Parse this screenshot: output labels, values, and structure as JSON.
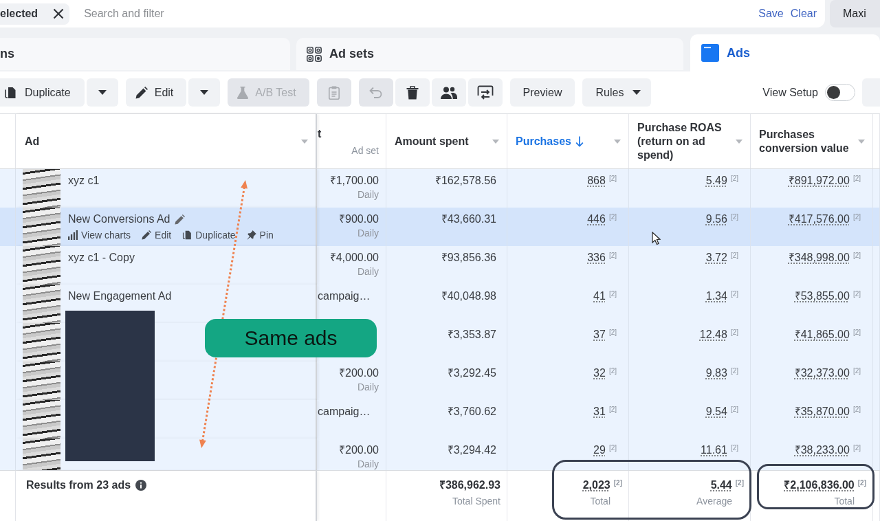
{
  "filter_bar": {
    "chip": {
      "label": "elected"
    },
    "search": {
      "placeholder": "Search and filter"
    },
    "links": [
      "Save",
      "Clear"
    ],
    "side_button": {
      "label": "Maxi"
    }
  },
  "level_tabs": [
    {
      "label": "ns",
      "selected": false
    },
    {
      "label": "Ad sets",
      "selected": false
    },
    {
      "label": "Ads",
      "selected": true
    }
  ],
  "toolbar": {
    "groups": [
      [
        {
          "kind": "button",
          "label": "Duplicate",
          "disabled": false
        },
        {
          "kind": "dropdown",
          "disabled": false
        }
      ],
      [
        {
          "kind": "button",
          "label": "Edit",
          "disabled": false
        },
        {
          "kind": "dropdown",
          "disabled": false
        }
      ],
      [
        {
          "kind": "button",
          "label": "A/B Test",
          "disabled": true
        }
      ],
      [
        {
          "kind": "icon",
          "disabled": true
        }
      ],
      [
        {
          "kind": "icon",
          "disabled": true
        },
        {
          "kind": "icon",
          "disabled": false
        },
        {
          "kind": "icon",
          "disabled": false
        },
        {
          "kind": "icon",
          "disabled": false
        }
      ],
      [
        {
          "kind": "button",
          "label": "Preview",
          "disabled": false
        }
      ],
      [
        {
          "kind": "menu",
          "label": "Rules",
          "disabled": false
        }
      ]
    ],
    "view_setup": {
      "label": "View Setup",
      "on": false
    }
  },
  "table": {
    "columns": [
      {
        "kind": "name",
        "label": "Ad",
        "sorted": false
      },
      {
        "kind": "cut",
        "label": "t",
        "sublabel": "Ad set",
        "sorted": false
      },
      {
        "kind": "metric",
        "label": "Amount spent",
        "sorted": false
      },
      {
        "kind": "metric",
        "label": "Purchases",
        "sorted": true
      },
      {
        "kind": "metric",
        "label": "Purchase ROAS (return on ad spend)",
        "sorted": false
      },
      {
        "kind": "metric",
        "label": "Purchases conversion value",
        "sorted": false
      }
    ],
    "rows": [
      {
        "name": "xyz c1",
        "hovered": false,
        "ad_set": {
          "kind": "budget",
          "value": "₹1,700.00",
          "period": "Daily"
        },
        "amount_spent": "₹162,578.56",
        "purchases": {
          "value": "868",
          "note": "[2]"
        },
        "roas": {
          "value": "5.49",
          "note": "[2]"
        },
        "conversion_value": {
          "value": "₹891,972.00",
          "note": "[2]"
        }
      },
      {
        "name": "New Conversions Ad",
        "hovered": true,
        "actions": [
          "View charts",
          "Edit",
          "Duplicate",
          "Pin"
        ],
        "ad_set": {
          "kind": "budget",
          "value": "₹900.00",
          "period": "Daily"
        },
        "amount_spent": "₹43,660.31",
        "purchases": {
          "value": "446",
          "note": "[2]"
        },
        "roas": {
          "value": "9.56",
          "note": "[2]"
        },
        "conversion_value": {
          "value": "₹417,576.00",
          "note": "[2]"
        }
      },
      {
        "name": "xyz c1 - Copy",
        "hovered": false,
        "ad_set": {
          "kind": "budget",
          "value": "₹4,000.00",
          "period": "Daily"
        },
        "amount_spent": "₹93,856.36",
        "purchases": {
          "value": "336",
          "note": "[2]"
        },
        "roas": {
          "value": "3.72",
          "note": "[2]"
        },
        "conversion_value": {
          "value": "₹348,998.00",
          "note": "[2]"
        }
      },
      {
        "name": "New Engagement Ad",
        "hovered": false,
        "ad_set": {
          "kind": "text",
          "value": "campaig…"
        },
        "amount_spent": "₹40,048.98",
        "purchases": {
          "value": "41",
          "note": "[2]"
        },
        "roas": {
          "value": "1.34",
          "note": "[2]"
        },
        "conversion_value": {
          "value": "₹53,855.00",
          "note": "[2]"
        }
      },
      {
        "hovered": false,
        "amount_spent": "₹3,353.87",
        "purchases": {
          "value": "37",
          "note": "[2]"
        },
        "roas": {
          "value": "12.48",
          "note": "[2]"
        },
        "conversion_value": {
          "value": "₹41,865.00",
          "note": "[2]"
        }
      },
      {
        "hovered": false,
        "ad_set": {
          "kind": "budget",
          "value": "₹200.00",
          "period": "Daily"
        },
        "amount_spent": "₹3,292.45",
        "purchases": {
          "value": "32",
          "note": "[2]"
        },
        "roas": {
          "value": "9.83",
          "note": "[2]"
        },
        "conversion_value": {
          "value": "₹32,373.00",
          "note": "[2]"
        }
      },
      {
        "hovered": false,
        "ad_set": {
          "kind": "text",
          "value": "campaig…"
        },
        "amount_spent": "₹3,760.62",
        "purchases": {
          "value": "31",
          "note": "[2]"
        },
        "roas": {
          "value": "9.54",
          "note": "[2]"
        },
        "conversion_value": {
          "value": "₹35,870.00",
          "note": "[2]"
        }
      },
      {
        "hovered": false,
        "ad_set": {
          "kind": "budget",
          "value": "₹200.00",
          "period": "Daily"
        },
        "amount_spent": "₹3,294.42",
        "purchases": {
          "value": "29",
          "note": "[2]"
        },
        "roas": {
          "value": "11.61",
          "note": "[2]"
        },
        "conversion_value": {
          "value": "₹38,233.00",
          "note": "[2]"
        }
      }
    ],
    "footer": {
      "label": "Results from 23 ads",
      "amount_spent": {
        "value": "₹386,962.93",
        "caption": "Total Spent"
      },
      "purchases": {
        "value": "2,023",
        "note": "[2]",
        "caption": "Total"
      },
      "roas": {
        "value": "5.44",
        "note": "[2]",
        "caption": "Average"
      },
      "conversion_value": {
        "value": "₹2,106,836.00",
        "note": "[2]",
        "caption": "Total"
      }
    }
  },
  "annotation": {
    "callout": {
      "label": "Same ads"
    }
  }
}
